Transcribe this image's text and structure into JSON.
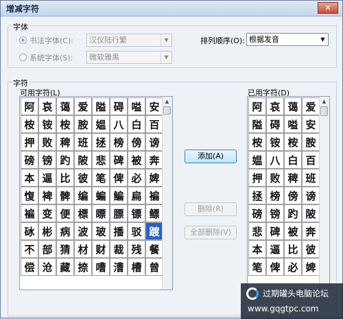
{
  "window": {
    "title": "增减字符",
    "buttons": {
      "close": "✕"
    }
  },
  "font_group": {
    "legend": "字体",
    "calligraphy": {
      "label": "书法字体(C):",
      "value": "汉仪陆行繁"
    },
    "system": {
      "label": "系统字体(S):",
      "value": "微软雅黑"
    },
    "sort": {
      "label": "排列顺序(O):",
      "value": "根据发音"
    }
  },
  "char_group": {
    "legend": "字符",
    "available": {
      "label": "可用字符(L)",
      "chars": [
        "阿",
        "哀",
        "蔼",
        "爱",
        "隘",
        "碍",
        "嗌",
        "安",
        "桉",
        "铵",
        "桉",
        "胺",
        "媪",
        "八",
        "白",
        "百",
        "押",
        "败",
        "稗",
        "班",
        "拯",
        "榜",
        "傍",
        "谤",
        "磅",
        "镑",
        "趵",
        "陂",
        "悲",
        "碑",
        "被",
        "奔",
        "本",
        "逼",
        "比",
        "彼",
        "笔",
        "俾",
        "必",
        "婢",
        "愎",
        "裨",
        "髀",
        "编",
        "蝙",
        "鳊",
        "扁",
        "褊",
        "褊",
        "变",
        "便",
        "標",
        "瞟",
        "膘",
        "镖",
        "鳔",
        "砅",
        "彬",
        "病",
        "波",
        "玻",
        "播",
        "驳",
        "踱",
        "不",
        "部",
        "猜",
        "材",
        "财",
        "裁",
        "残",
        "餐",
        "偿",
        "沧",
        "藏",
        "捺",
        "嘈",
        "漕",
        "槽",
        "曾"
      ],
      "selected_index": 63
    },
    "used": {
      "label": "已用字符(D)",
      "chars": [
        "阿",
        "哀",
        "蔼",
        "爱",
        "隘",
        "碍",
        "嗌",
        "安",
        "桉",
        "铵",
        "桉",
        "胺",
        "媪",
        "八",
        "白",
        "百",
        "押",
        "败",
        "稗",
        "班",
        "拯",
        "榜",
        "傍",
        "谤",
        "磅",
        "镑",
        "趵",
        "陂",
        "悲",
        "碑",
        "被",
        "奔",
        "本",
        "逼",
        "比",
        "彼",
        "笔",
        "俾",
        "必",
        "婢"
      ]
    },
    "buttons": {
      "add": "添加(A)",
      "delete": "删除(R)",
      "delete_all": "全部删除(V)"
    }
  },
  "watermark": {
    "line1": "过期罐头电脑论坛",
    "line2": "www.gqgtpc.com"
  }
}
